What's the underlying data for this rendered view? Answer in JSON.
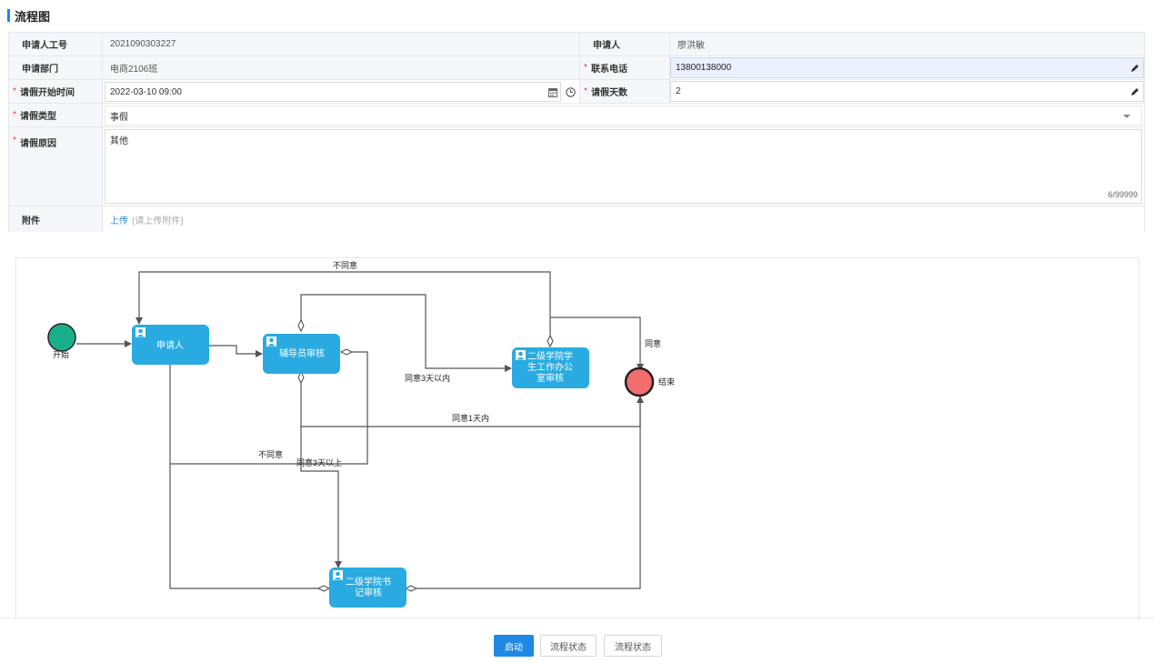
{
  "header": {
    "title": "流程图"
  },
  "form": {
    "applicant_id_label": "申请人工号",
    "applicant_id": "2021090303227",
    "applicant_label": "申请人",
    "applicant": "廖洪敏",
    "dept_label": "申请部门",
    "dept": "电商2106班",
    "phone_label": "联系电话",
    "phone": "13800138000",
    "start_time_label": "请假开始时间",
    "start_time": "2022-03-10 09:00",
    "days_label": "请假天数",
    "days": "2",
    "type_label": "请假类型",
    "type": "事假",
    "reason_label": "请假原因",
    "reason": "其他",
    "reason_counter": "6/99999",
    "attachment_label": "附件",
    "upload_label": "上传",
    "upload_hint": "(请上传附件)",
    "required_mark": "*"
  },
  "flow": {
    "start_label": "开始",
    "end_label": "结束",
    "node_applicant": "申请人",
    "node_counselor": "辅导员审核",
    "node_office_1": "二级学院学",
    "node_office_2": "生工作办公",
    "node_office_3": "室审核",
    "node_secretary_1": "二级学院书",
    "node_secretary_2": "记审核",
    "edge_disagree_top": "不同意",
    "edge_agree": "同意",
    "edge_agree_3_within": "同意3天以内",
    "edge_agree_1_within": "同意1天内",
    "edge_disagree_mid": "不同意",
    "edge_agree_3_above": "同意3天以上",
    "colors": {
      "node": "#29abe2",
      "start": "#1aaf8b",
      "end": "#f26d6d",
      "line": "#555555"
    }
  },
  "buttons": {
    "start": "启动",
    "status1": "流程状态",
    "status2": "流程状态"
  }
}
